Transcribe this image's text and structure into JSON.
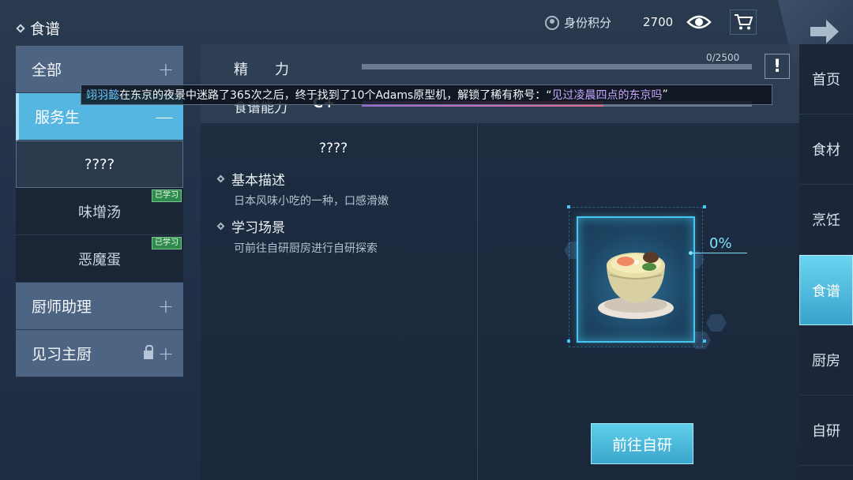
{
  "header": {
    "title": "食谱",
    "identity_label": "身份积分",
    "identity_score": "2700"
  },
  "left_menu": {
    "categories": [
      {
        "label": "全部",
        "toggle": "+"
      },
      {
        "label": "服务生",
        "toggle": "—"
      },
      {
        "label": "厨师助理",
        "toggle": "+"
      },
      {
        "label": "见习主厨",
        "toggle": "+"
      }
    ],
    "recipes": [
      {
        "label": "????",
        "badge": ""
      },
      {
        "label": "味增汤",
        "badge": "已学习"
      },
      {
        "label": "恶魔蛋",
        "badge": "已学习"
      }
    ]
  },
  "stats": {
    "energy_label": "精力",
    "energy_count": "0/2500",
    "energy_progress": 0,
    "ability_label": "食谱能力",
    "ability_grade": "C+",
    "ability_progress": 0.62,
    "alert_symbol": "!"
  },
  "detail": {
    "dish_name": "????",
    "desc_title": "基本描述",
    "desc_text": "日本风味小吃的一种，口感滑嫩",
    "learn_title": "学习场景",
    "learn_text": "可前往自研厨房进行自研探索",
    "progress_percent": "0%",
    "goto_button": "前往自研"
  },
  "right_nav": [
    "首页",
    "食材",
    "烹饪",
    "食谱",
    "厨房",
    "自研"
  ],
  "banner": {
    "player": "翊羽懿",
    "message": "在东京的夜景中迷路了365次之后，终于找到了10个Adams原型机，解锁了稀有称号：“",
    "title_name": "见过凌晨四点的东京吗",
    "close_quote": "”"
  },
  "colors": {
    "accent": "#56b6e2",
    "badge_green": "#2f8a4e",
    "highlight_blue": "#7fe0ff",
    "title_purple": "#c7a7ff"
  }
}
